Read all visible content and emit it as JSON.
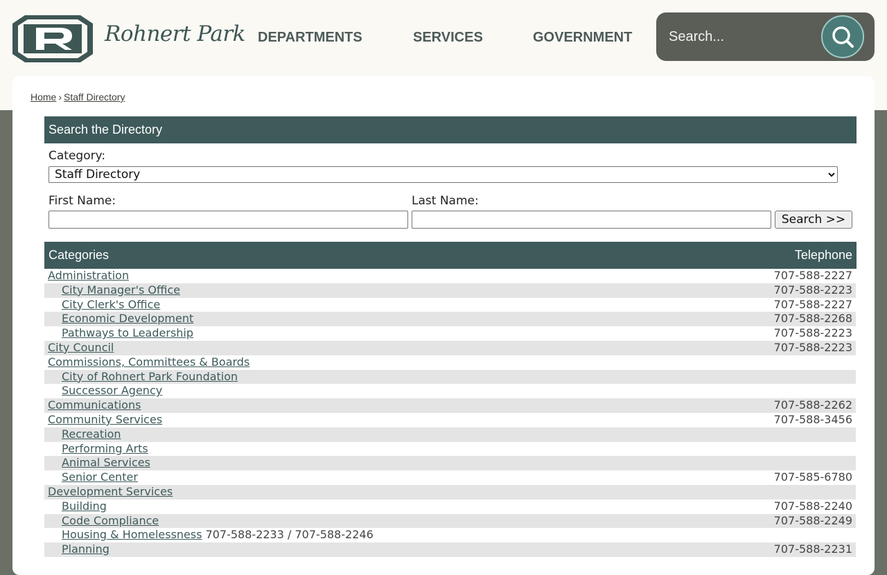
{
  "header": {
    "logo_text": "Rohnert Park",
    "nav": [
      "DEPARTMENTS",
      "SERVICES",
      "GOVERNMENT"
    ],
    "search_placeholder": "Search..."
  },
  "breadcrumb": {
    "home": "Home",
    "separator": "›",
    "current": "Staff Directory"
  },
  "directory_search": {
    "title": "Search the Directory",
    "category_label": "Category:",
    "category_value": "Staff Directory",
    "first_name_label": "First Name:",
    "first_name_value": "",
    "last_name_label": "Last Name:",
    "last_name_value": "",
    "search_button": "Search >>"
  },
  "table": {
    "header_categories": "Categories",
    "header_telephone": "Telephone",
    "rows": [
      {
        "name": "Administration",
        "phone": "707-588-2227",
        "level": 0
      },
      {
        "name": "City Manager's Office",
        "phone": "707-588-2223",
        "level": 1
      },
      {
        "name": "City Clerk's Office",
        "phone": "707-588-2227",
        "level": 1
      },
      {
        "name": "Economic Development",
        "phone": "707-588-2268",
        "level": 1
      },
      {
        "name": "Pathways to Leadership",
        "phone": "707-588-2223",
        "level": 1
      },
      {
        "name": "City Council",
        "phone": "707-588-2223",
        "level": 0
      },
      {
        "name": "Commissions, Committees & Boards",
        "phone": "",
        "level": 0
      },
      {
        "name": "City of Rohnert Park Foundation",
        "phone": "",
        "level": 1
      },
      {
        "name": "Successor Agency",
        "phone": "",
        "level": 1
      },
      {
        "name": "Communications",
        "phone": "707-588-2262",
        "level": 0
      },
      {
        "name": "Community Services",
        "phone": "707-588-3456",
        "level": 0
      },
      {
        "name": "Recreation",
        "phone": "",
        "level": 1
      },
      {
        "name": "Performing Arts",
        "phone": "",
        "level": 1
      },
      {
        "name": "Animal Services",
        "phone": "",
        "level": 1
      },
      {
        "name": "Senior Center",
        "phone": "707-585-6780",
        "level": 1
      },
      {
        "name": "Development Services",
        "phone": "",
        "level": 0
      },
      {
        "name": "Building",
        "phone": "707-588-2240",
        "level": 1
      },
      {
        "name": "Code Compliance",
        "phone": "707-588-2249",
        "level": 1
      },
      {
        "name": "Housing & Homelessness",
        "phone": "",
        "inline_phone": "707-588-2233 / 707-588-2246",
        "level": 1
      },
      {
        "name": "Planning",
        "phone": "707-588-2231",
        "level": 1
      }
    ]
  },
  "colors": {
    "header_bg": "#faf9f4",
    "page_bg": "#6b7067",
    "bar_bg": "#3e5a5b",
    "search_bg": "#5a5e57",
    "search_button": "#4a7b78",
    "link": "#3e5a5b",
    "alt_row": "#e4e4e4"
  }
}
